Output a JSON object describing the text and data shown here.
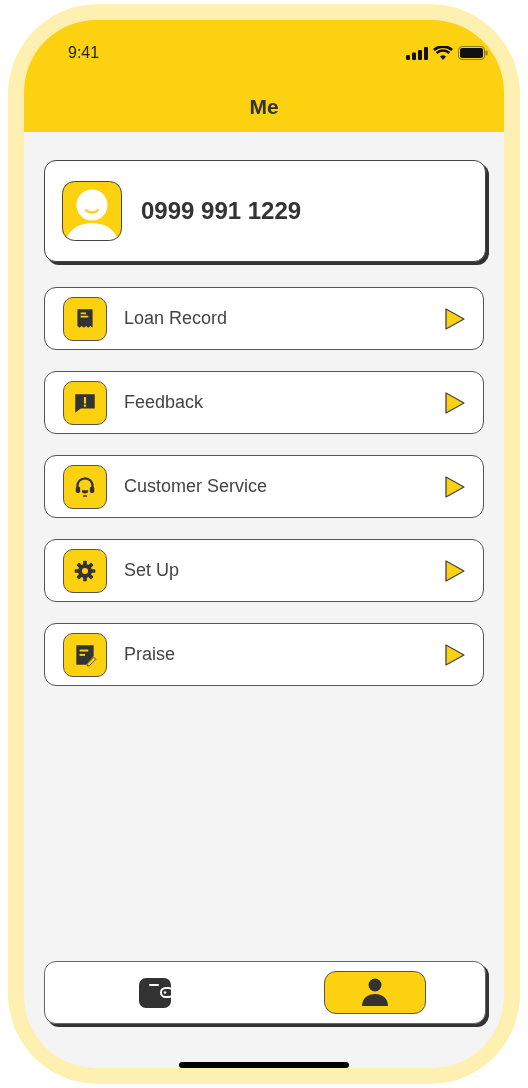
{
  "status_bar": {
    "time": "9:41"
  },
  "header": {
    "title": "Me"
  },
  "profile": {
    "phone": "0999 991 1229"
  },
  "menu": [
    {
      "label": "Loan Record"
    },
    {
      "label": "Feedback"
    },
    {
      "label": "Customer Service"
    },
    {
      "label": "Set Up"
    },
    {
      "label": "Praise"
    }
  ],
  "nav": [
    {
      "selected": false
    },
    {
      "selected": true
    }
  ]
}
